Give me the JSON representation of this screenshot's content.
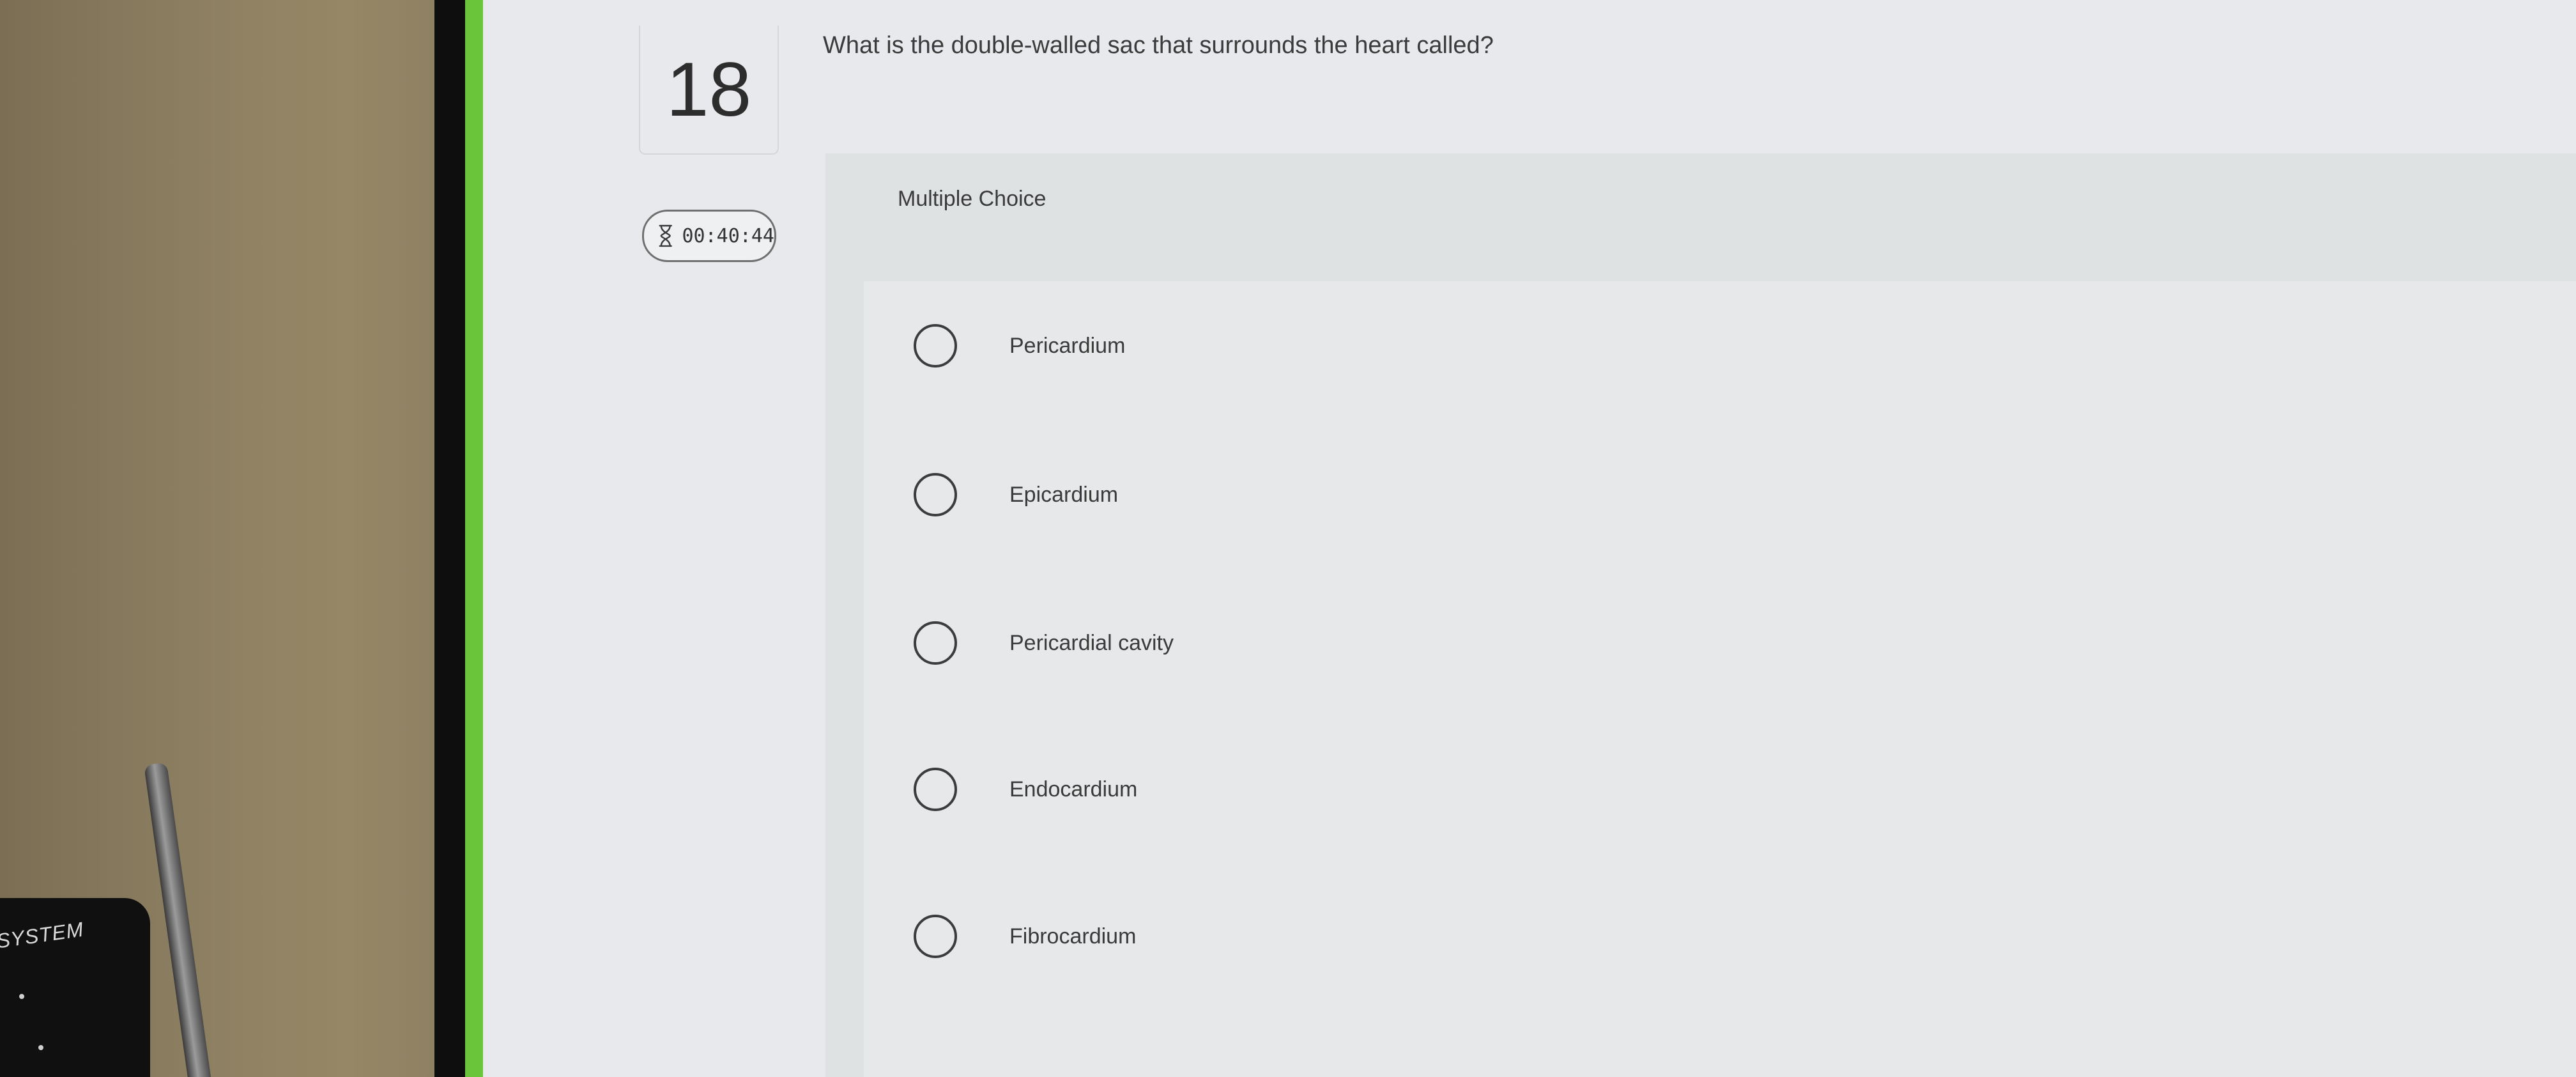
{
  "question": {
    "number": "18",
    "text": "What is the double-walled sac that surrounds the heart called?",
    "type": "Multiple Choice"
  },
  "timer": {
    "value": "00:40:44",
    "icon": "hourglass-icon"
  },
  "options": [
    {
      "label": "Pericardium"
    },
    {
      "label": "Epicardium"
    },
    {
      "label": "Pericardial cavity"
    },
    {
      "label": "Endocardium"
    },
    {
      "label": "Fibrocardium"
    }
  ],
  "environment": {
    "device_text": "SYSTEM"
  },
  "colors": {
    "accent_bar": "#6ac53a",
    "screen_bg": "#e7e9ec",
    "panel_bg": "#dfe2e3"
  }
}
